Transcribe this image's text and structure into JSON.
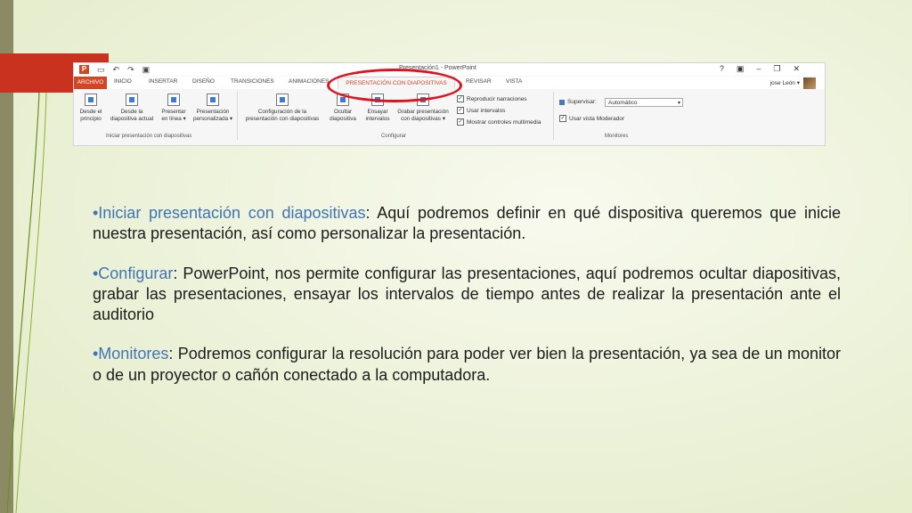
{
  "titlebar": {
    "doc_title": "Presentación1 - PowerPoint",
    "qat": [
      "save-icon",
      "undo-icon",
      "redo-icon",
      "start-icon"
    ],
    "controls": [
      "?",
      "▣",
      "–",
      "❐",
      "✕"
    ],
    "logo": "P"
  },
  "tabs": [
    "ARCHIVO",
    "INICIO",
    "INSERTAR",
    "DISEÑO",
    "TRANSICIONES",
    "ANIMACIONES",
    "PRESENTACIÓN CON DIAPOSITIVAS",
    "REVISAR",
    "VISTA"
  ],
  "user": "jose León ▾",
  "ribbon": {
    "buttons": [
      {
        "label1": "Desde el",
        "label2": "principio"
      },
      {
        "label1": "Desde la",
        "label2": "diapositiva actual"
      },
      {
        "label1": "Presentar",
        "label2": "en línea ▾"
      },
      {
        "label1": "Presentación",
        "label2": "personalizada ▾"
      },
      {
        "label1": "Configuración de la",
        "label2": "presentación con diapositivas"
      },
      {
        "label1": "Ocultar",
        "label2": "diapositiva"
      },
      {
        "label1": "Ensayar",
        "label2": "intervalos"
      },
      {
        "label1": "Grabar presentación",
        "label2": "con diapositivas ▾"
      }
    ],
    "checks": [
      "Reproducir narraciones",
      "Usar intervalos",
      "Mostrar controles multimedia"
    ],
    "monitor_label": "Supervisar:",
    "monitor_value": "Automático",
    "presenter_check": "Usar vista Moderador",
    "groups": [
      "Iniciar presentación con diapositivas",
      "Configurar",
      "Monitores"
    ]
  },
  "bullets": [
    {
      "term": "•Iniciar presentación con diapositivas",
      "rest": ": Aquí podremos definir en qué dispositiva queremos que inicie nuestra presentación, así como personalizar la presentación."
    },
    {
      "term": "•Configurar",
      "rest": ": PowerPoint, nos permite configurar las presentaciones, aquí podremos ocultar diapositivas, grabar las presentaciones, ensayar los intervalos de tiempo antes de realizar la presentación ante el auditorio"
    },
    {
      "term": "•Monitores",
      "rest": ": Podremos configurar la resolución para poder ver bien la presentación, ya sea de un monitor o de un proyector o cañón conectado a la computadora."
    }
  ],
  "colors": {
    "accent": "#3f75b3",
    "ppt": "#d24625",
    "highlight": "#e0121c"
  }
}
